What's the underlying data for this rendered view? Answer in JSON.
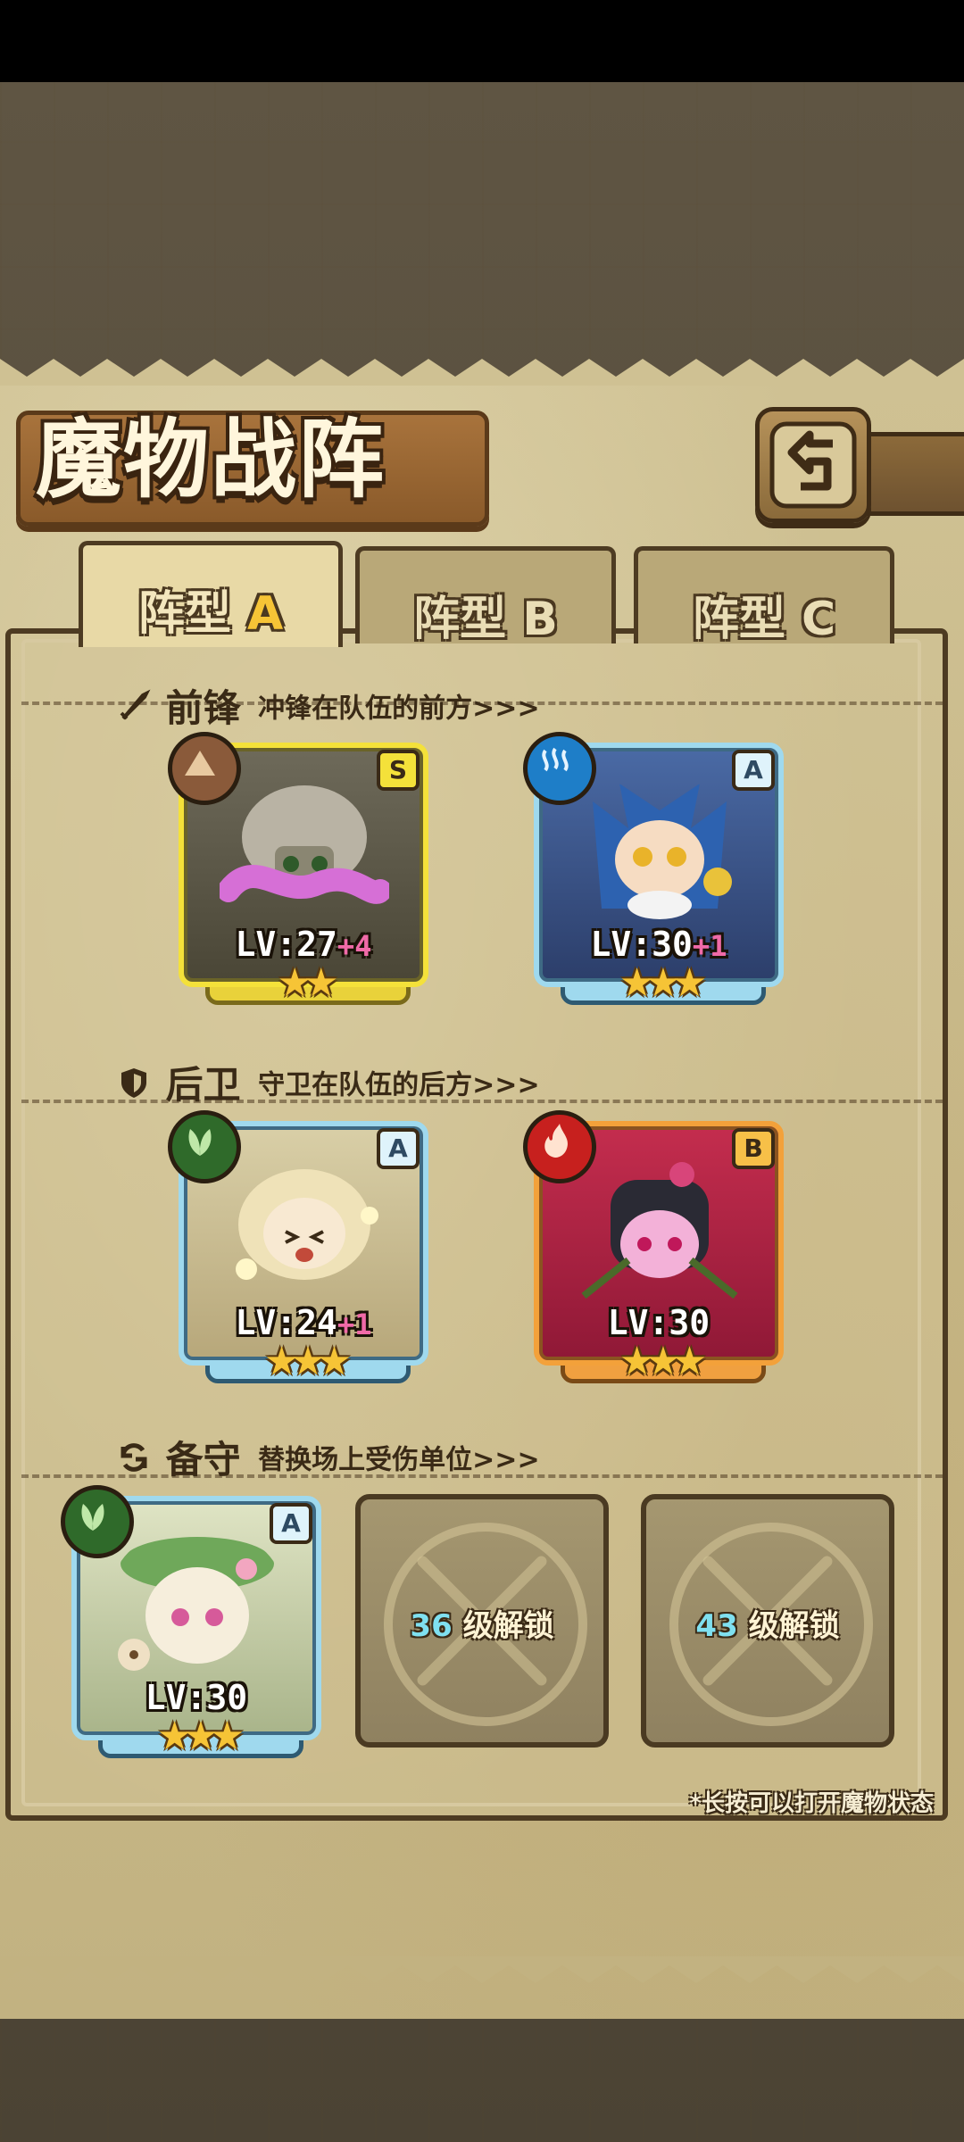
{
  "title": "魔物战阵",
  "back_icon": "back-arrow-icon",
  "tabs": [
    {
      "text": "阵型",
      "letter": "A",
      "active": true
    },
    {
      "text": "阵型",
      "letter": "B",
      "active": false
    },
    {
      "text": "阵型",
      "letter": "C",
      "active": false
    }
  ],
  "sections": {
    "front": {
      "heading": "前锋",
      "desc": "冲锋在队伍的前方>>>",
      "icon": "sword-icon"
    },
    "rear": {
      "heading": "后卫",
      "desc": "守卫在队伍的后方>>>",
      "icon": "shield-icon"
    },
    "reserve": {
      "heading": "备守",
      "desc": "替换场上受伤单位>>>",
      "icon": "swap-icon"
    }
  },
  "units": [
    {
      "rank": "S",
      "element": "earth-element-icon",
      "lv": "LV:27",
      "bonus": "+4",
      "stars": "★★",
      "star_count": 2,
      "frame": "s"
    },
    {
      "rank": "A",
      "element": "water-element-icon",
      "lv": "LV:30",
      "bonus": "+1",
      "stars": "★★★",
      "star_count": 3,
      "frame": "a"
    },
    {
      "rank": "A",
      "element": "grass-element-icon",
      "lv": "LV:24",
      "bonus": "+1",
      "stars": "★★★",
      "star_count": 3,
      "frame": "a2"
    },
    {
      "rank": "B",
      "element": "fire-element-icon",
      "lv": "LV:30",
      "bonus": "",
      "stars": "★★★",
      "star_count": 3,
      "frame": "b"
    },
    {
      "rank": "A",
      "element": "grass-element-icon",
      "lv": "LV:30",
      "bonus": "",
      "stars": "★★★",
      "star_count": 3,
      "frame": "a3"
    }
  ],
  "locked_slots": [
    {
      "level": "36",
      "text": "级解锁"
    },
    {
      "level": "43",
      "text": "级解锁"
    }
  ],
  "footnote": "*长按可以打开魔物状态",
  "colors": {
    "gold": "#f6c436",
    "bonus_pink": "#f06aa8",
    "unlock_cyan": "#7fe0f0",
    "parchment": "#c8b888"
  }
}
